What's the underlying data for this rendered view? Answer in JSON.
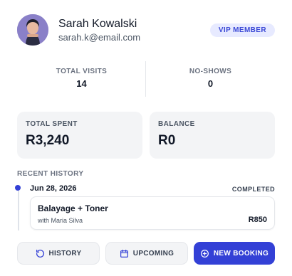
{
  "client": {
    "name": "Sarah Kowalski",
    "email": "sarah.k@email.com",
    "badge": "VIP MEMBER"
  },
  "stats": {
    "total_visits_label": "TOTAL VISITS",
    "total_visits_value": "14",
    "no_shows_label": "NO-SHOWS",
    "no_shows_value": "0"
  },
  "financials": {
    "total_spent_label": "TOTAL SPENT",
    "total_spent_value": "R3,240",
    "balance_label": "BALANCE",
    "balance_value": "R0"
  },
  "history": {
    "section_label": "RECENT HISTORY",
    "items": [
      {
        "date": "Jun 28, 2026",
        "status": "COMPLETED",
        "service": "Balayage + Toner",
        "staff": "with Maria Silva",
        "price": "R850"
      }
    ]
  },
  "actions": {
    "history_label": "HISTORY",
    "upcoming_label": "UPCOMING",
    "new_booking_label": "NEW BOOKING"
  },
  "colors": {
    "accent": "#3340d6",
    "badge_bg": "#e7eaff",
    "card_bg": "#f3f4f6"
  },
  "icons": {
    "avatar": "avatar",
    "history": "history-icon",
    "upcoming": "calendar-icon",
    "new_booking": "plus-circle-icon"
  }
}
